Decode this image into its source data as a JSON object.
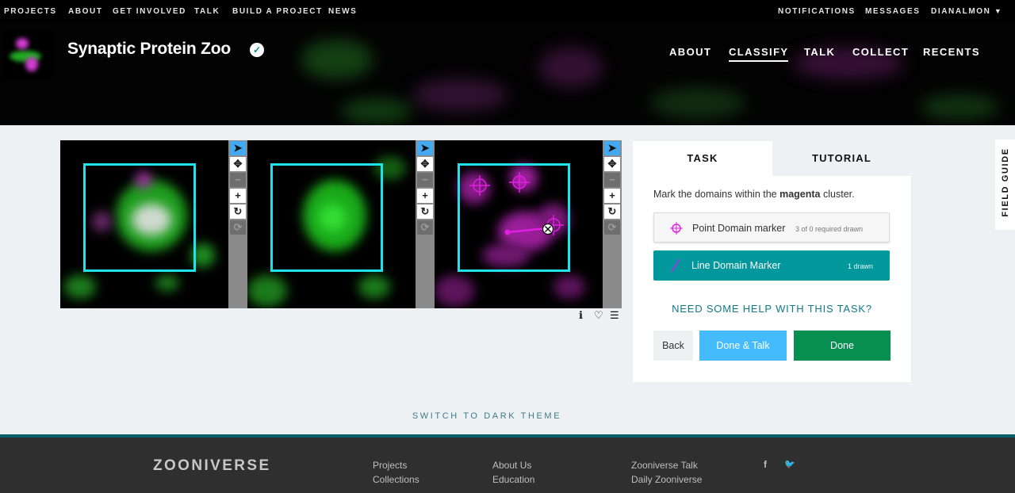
{
  "top_nav": {
    "left": [
      "PROJECTS",
      "ABOUT",
      "GET INVOLVED",
      "TALK",
      "BUILD A PROJECT",
      "NEWS"
    ],
    "right": [
      "NOTIFICATIONS",
      "MESSAGES",
      "DIANALMON"
    ]
  },
  "project": {
    "title": "Synaptic Protein Zoo",
    "nav": [
      "ABOUT",
      "CLASSIFY",
      "TALK",
      "COLLECT",
      "RECENTS"
    ],
    "active_nav": "CLASSIFY"
  },
  "viewer": {
    "frames": 3,
    "tools": [
      "pointer-icon",
      "pan-icon",
      "zoom-out-icon",
      "zoom-in-icon",
      "rotate-icon",
      "reset-icon"
    ],
    "tool_glyphs": [
      "➤",
      "✥",
      "−",
      "+",
      "↻",
      "⟳"
    ],
    "below_icons": [
      "info-icon",
      "heart-icon",
      "list-icon"
    ],
    "below_glyphs": [
      "ℹ",
      "♡",
      "☰"
    ]
  },
  "task_panel": {
    "tabs": [
      "TASK",
      "TUTORIAL"
    ],
    "active_tab": "TASK",
    "instruction_prefix": "Mark the domains within the ",
    "instruction_bold": "magenta",
    "instruction_suffix": " cluster.",
    "tools": [
      {
        "label": "Point Domain marker",
        "count": "3 of 0 required drawn",
        "selected": false,
        "color": "#e020e0"
      },
      {
        "label": "Line Domain Marker",
        "count": "1 drawn",
        "selected": true,
        "color": "#9b3bd6"
      }
    ],
    "help": "NEED SOME HELP WITH THIS TASK?",
    "buttons": {
      "back": "Back",
      "done_talk": "Done & Talk",
      "done": "Done"
    }
  },
  "field_guide": "FIELD GUIDE",
  "theme_switch": "SWITCH TO DARK THEME",
  "footer": {
    "logo": "ZOONIVERSE",
    "col1": [
      "Projects",
      "Collections"
    ],
    "col2": [
      "About Us",
      "Education"
    ],
    "col3": [
      "Zooniverse Talk",
      "Daily Zooniverse"
    ],
    "social": [
      "f",
      "🐦"
    ]
  },
  "colors": {
    "accent": "#00979d",
    "marker": "#e020e0",
    "frame_box": "#1ee3ec",
    "done": "#078f52",
    "done_talk": "#43bbfd"
  }
}
